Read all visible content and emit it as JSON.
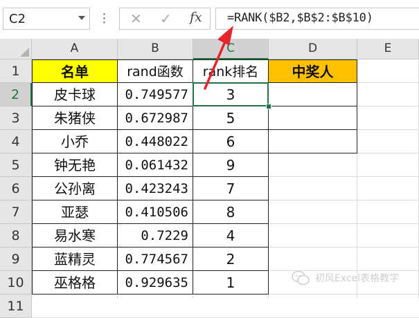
{
  "name_box": {
    "value": "C2"
  },
  "formula_bar": {
    "cancel_glyph": "✕",
    "enter_glyph": "✓",
    "fx_label": "fx",
    "formula": "=RANK($B2,$B$2:$B$10)"
  },
  "columns": [
    "A",
    "B",
    "C",
    "D",
    "E"
  ],
  "rows": [
    "1",
    "2",
    "3",
    "4",
    "5",
    "6",
    "7",
    "8",
    "9",
    "10",
    "11"
  ],
  "selected_cell": {
    "column": "C",
    "row": "2"
  },
  "headers": {
    "a": "名单",
    "b": "rand函数",
    "c": "rank排名",
    "d": "中奖人"
  },
  "table": [
    {
      "name": "皮卡球",
      "rand": "0.749577",
      "rank": "3",
      "winner": ""
    },
    {
      "name": "朱猪侠",
      "rand": "0.672987",
      "rank": "5",
      "winner": ""
    },
    {
      "name": "小乔",
      "rand": "0.448022",
      "rank": "6",
      "winner": ""
    },
    {
      "name": "钟无艳",
      "rand": "0.061432",
      "rank": "9"
    },
    {
      "name": "公孙离",
      "rand": "0.423243",
      "rank": "7"
    },
    {
      "name": "亚瑟",
      "rand": "0.410506",
      "rank": "8"
    },
    {
      "name": "易水寒",
      "rand": "0.7229",
      "rank": "4"
    },
    {
      "name": "蓝精灵",
      "rand": "0.774567",
      "rank": "2"
    },
    {
      "name": "巫格格",
      "rand": "0.929635",
      "rank": "1"
    }
  ],
  "colors": {
    "header_yellow": "#ffff00",
    "header_orange": "#ffc000",
    "excel_green": "#217346",
    "arrow_red": "#e8252b"
  },
  "watermark": {
    "text": "初风Excel表格教学",
    "icon": "wechat-icon"
  }
}
